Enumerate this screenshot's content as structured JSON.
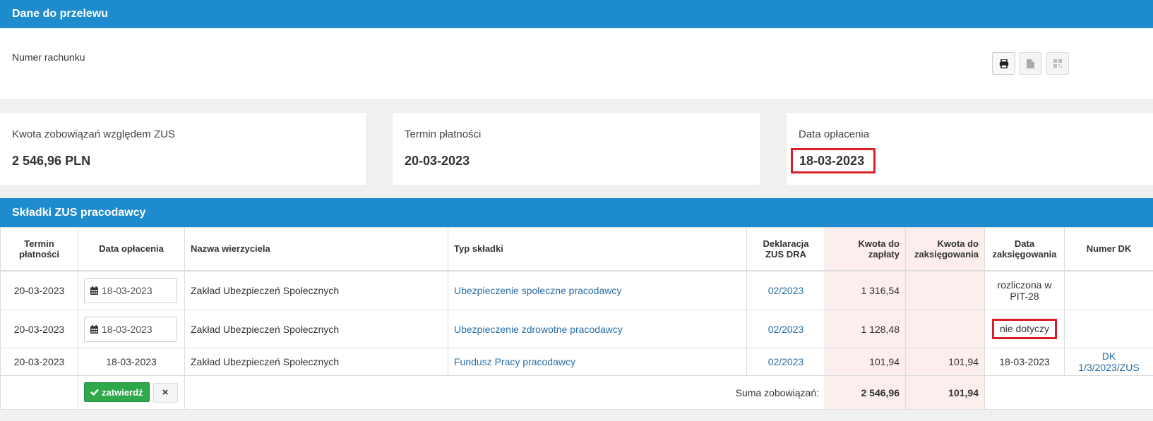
{
  "transfer_section": {
    "title": "Dane do przelewu",
    "account_label": "Numer rachunku",
    "icons": [
      "print-icon",
      "document-icon",
      "qr-code-icon"
    ]
  },
  "cards": [
    {
      "label": "Kwota zobowiązań względem ZUS",
      "value": "2 546,96 PLN"
    },
    {
      "label": "Termin płatności",
      "value": "20-03-2023"
    },
    {
      "label": "Data opłacenia",
      "value": "18-03-2023"
    }
  ],
  "contributions": {
    "title": "Składki ZUS pracodawcy",
    "headers": {
      "due": "Termin płatności",
      "paid": "Data opłacenia",
      "creditor": "Nazwa wierzyciela",
      "type": "Typ składki",
      "declaration": "Deklaracja ZUS DRA",
      "amount_due": "Kwota do zapłaty",
      "amount_booked": "Kwota do zaksięgowania",
      "booking_date": "Data zaksięgowania",
      "dk_number": "Numer DK"
    },
    "rows": [
      {
        "due": "20-03-2023",
        "paid": "18-03-2023",
        "creditor": "Zakład Ubezpieczeń Społecznych",
        "type": "Ubezpieczenie społeczne pracodawcy",
        "declaration": "02/2023",
        "amount_due": "1 316,54",
        "amount_booked": "",
        "booking_date": "rozliczona w PIT-28",
        "dk_number": ""
      },
      {
        "due": "20-03-2023",
        "paid": "18-03-2023",
        "creditor": "Zakład Ubezpieczeń Społecznych",
        "type": "Ubezpieczenie zdrowotne pracodawcy",
        "declaration": "02/2023",
        "amount_due": "1 128,48",
        "amount_booked": "",
        "booking_date": "nie dotyczy",
        "dk_number": ""
      },
      {
        "due": "20-03-2023",
        "paid": "18-03-2023",
        "creditor": "Zakład Ubezpieczeń Społecznych",
        "type": "Fundusz Pracy pracodawcy",
        "declaration": "02/2023",
        "amount_due": "101,94",
        "amount_booked": "101,94",
        "booking_date": "18-03-2023",
        "dk_number": "DK 1/3/2023/ZUS"
      }
    ],
    "summary": {
      "confirm_label": "zatwierdź",
      "cancel_label": "×",
      "sum_label": "Suma zobowiązań:",
      "sum_due": "2 546,96",
      "sum_booked": "101,94"
    }
  },
  "colors": {
    "header": "#1e8bcd",
    "highlight": "#d9202a",
    "confirm": "#2ea84a",
    "link": "#2a6ea5",
    "amount_bg": "#fbeeed"
  }
}
